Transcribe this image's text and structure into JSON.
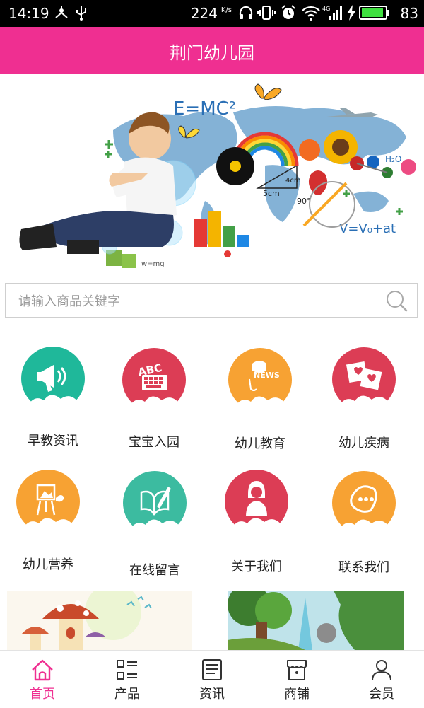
{
  "status_bar": {
    "time": "14:19",
    "net_speed": "224",
    "net_unit": "K/s",
    "battery": "83",
    "icons": [
      "usb-share-icon",
      "usb-icon",
      "headphones-icon",
      "vibrate-icon",
      "alarm-icon",
      "wifi-icon",
      "signal-4g-icon",
      "charging-icon",
      "battery-icon"
    ]
  },
  "header": {
    "title": "荆门幼儿园"
  },
  "banner": {
    "formulas": [
      "E=MC²",
      "V=V₀+at",
      "H₂O",
      "w=mg",
      "5cm",
      "4cm",
      "90°"
    ]
  },
  "search": {
    "placeholder": "请输入商品关键字"
  },
  "categories": [
    {
      "label": "早教资讯",
      "icon": "megaphone-icon",
      "color": "#1fb89a"
    },
    {
      "label": "宝宝入园",
      "icon": "abc-keyboard-icon",
      "color": "#dc3d55"
    },
    {
      "label": "幼儿教育",
      "icon": "news-icon",
      "color": "#f7a233"
    },
    {
      "label": "幼儿疾病",
      "icon": "photo-cards-icon",
      "color": "#dc3d55"
    },
    {
      "label": "幼儿营养",
      "icon": "easel-icon",
      "color": "#f7a233"
    },
    {
      "label": "在线留言",
      "icon": "book-pen-icon",
      "color": "#3cbba0"
    },
    {
      "label": "关于我们",
      "icon": "person-icon",
      "color": "#dc3d55"
    },
    {
      "label": "联系我们",
      "icon": "contact-icon",
      "color": "#f7a233"
    }
  ],
  "tabs": [
    {
      "label": "首页",
      "icon": "home-icon",
      "active": true
    },
    {
      "label": "产品",
      "icon": "product-grid-icon",
      "active": false
    },
    {
      "label": "资讯",
      "icon": "news-doc-icon",
      "active": false
    },
    {
      "label": "商铺",
      "icon": "shop-icon",
      "active": false
    },
    {
      "label": "会员",
      "icon": "member-icon",
      "active": false
    }
  ],
  "colors": {
    "brand": "#ef2f91",
    "active_tab": "#ef2f91"
  }
}
